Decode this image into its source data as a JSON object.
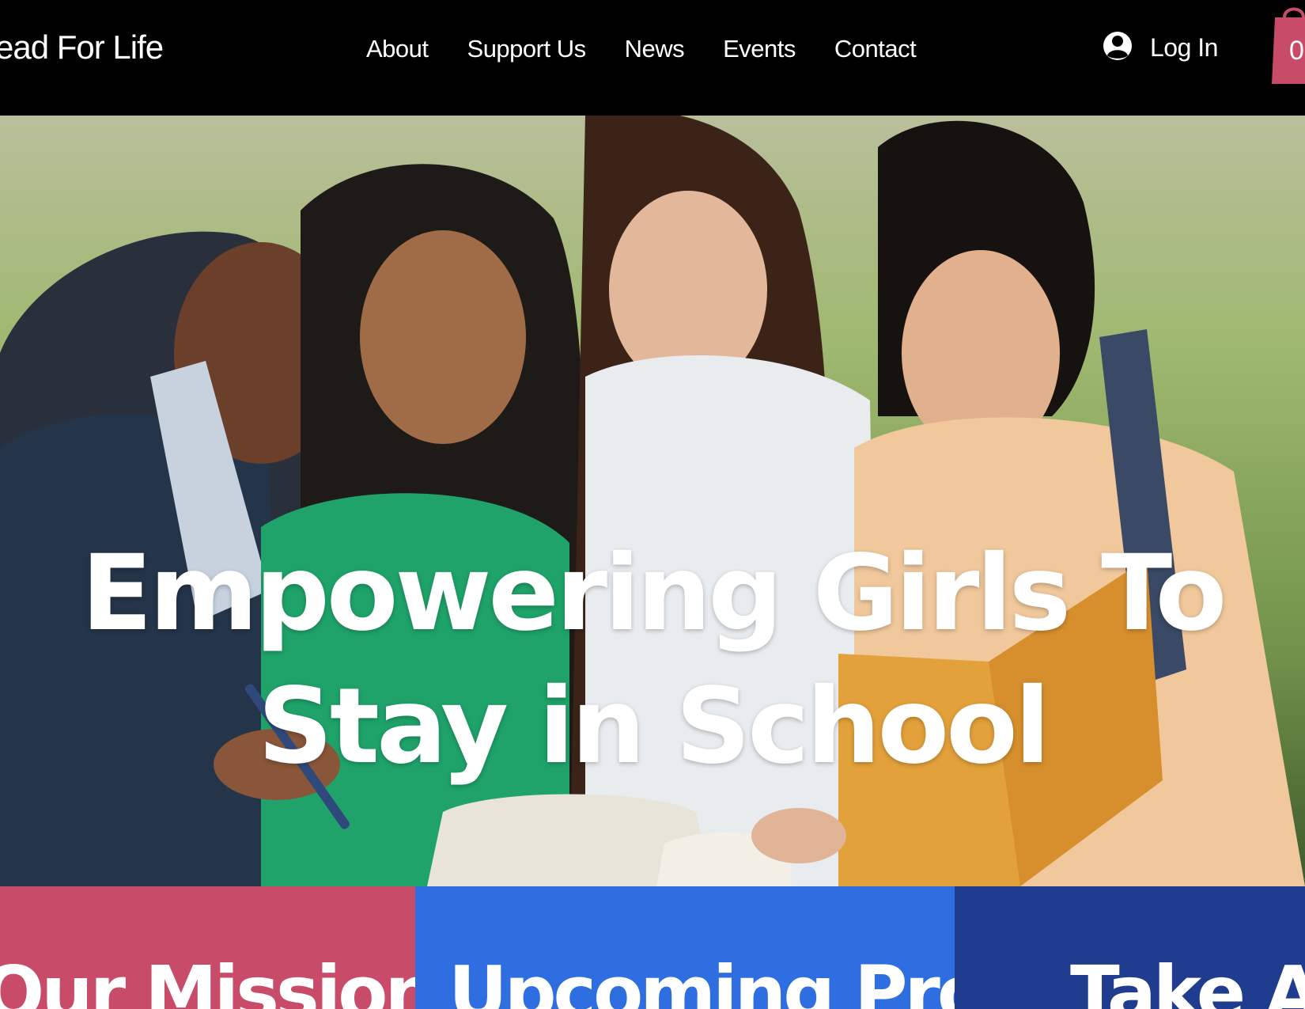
{
  "header": {
    "logo_text": "ead For Life",
    "nav": [
      {
        "label": "About"
      },
      {
        "label": "Support Us"
      },
      {
        "label": "News"
      },
      {
        "label": "Events"
      },
      {
        "label": "Contact"
      }
    ],
    "login_label": "Log In",
    "login_icon": "user-avatar-icon",
    "cart_icon": "shopping-bag-icon",
    "cart_count": "0"
  },
  "hero": {
    "title": "Empowering Girls To Stay in School",
    "image_alt": "Four girls reading books together outdoors"
  },
  "cards": [
    {
      "title": "Our Mission",
      "color": "#c94b6a"
    },
    {
      "title": "Upcoming Project",
      "color": "#2e6ee0"
    },
    {
      "title": "Take Acti",
      "color": "#1f3c8f"
    }
  ],
  "colors": {
    "header_bg": "#000000",
    "accent_pink": "#c94b6a",
    "accent_blue": "#2e6ee0",
    "accent_navy": "#1f3c8f"
  }
}
